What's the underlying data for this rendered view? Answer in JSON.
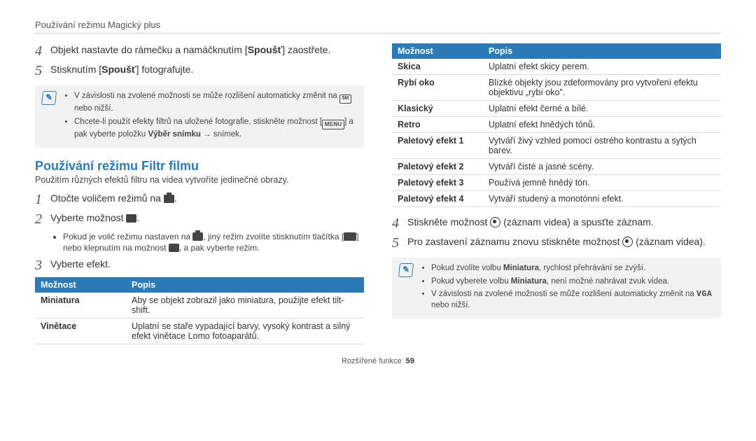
{
  "header": {
    "breadcrumb": "Používání režimu Magický plus"
  },
  "left": {
    "step4": {
      "num": "4",
      "pre": "Objekt nastavte do rámečku a namáčknutím [",
      "bold": "Spoušť",
      "post": "] zaostřete."
    },
    "step5": {
      "num": "5",
      "pre": "Stisknutím [",
      "bold": "Spoušť",
      "post": "] fotografujte."
    },
    "note1": {
      "li1a": "V závislosti na zvolené možnosti se může rozlišení automaticky změnit na ",
      "li1b": " nebo nižší.",
      "li2a": "Chcete-li použít efekty filtrů na uložené fotografie, stiskněte možnost [",
      "li2menu": "MENU",
      "li2b": "] a pak vyberte položku ",
      "li2bold": "Výběr snímku",
      "li2arrow": " → ",
      "li2c": "snímek."
    },
    "section_title": "Používání režimu Filtr filmu",
    "section_sub": "Použitím různých efektů filtru na videa vytvoříte jedinečné obrazy.",
    "s1": {
      "num": "1",
      "text": "Otočte voličem režimů na ",
      "post": "."
    },
    "s2": {
      "num": "2",
      "text": "Vyberte možnost ",
      "post": "."
    },
    "s2_bullet": {
      "a": "Pokud je volič režimu nastaven na ",
      "b": ", jiný režim zvolíte stisknutím tlačítka [",
      "c": "] nebo klepnutím na možnost ",
      "d": ", a pak vyberte režim."
    },
    "s3": {
      "num": "3",
      "text": "Vyberte efekt."
    },
    "table1": {
      "h1": "Možnost",
      "h2": "Popis",
      "rows": [
        {
          "opt": "Miniatura",
          "desc": "Aby se objekt zobrazil jako miniatura, použijte efekt tilt-shift."
        },
        {
          "opt": "Vinětace",
          "desc": "Uplatní se staře vypadající barvy, vysoký kontrast a silný efekt vinětace Lomo fotoaparátů."
        }
      ]
    }
  },
  "right": {
    "table2": {
      "h1": "Možnost",
      "h2": "Popis",
      "rows": [
        {
          "opt": "Skica",
          "desc": "Uplatní efekt skicy perem."
        },
        {
          "opt": "Rybí oko",
          "desc": "Blízké objekty jsou zdeformovány pro vytvoření efektu objektivu „rybí oko\"."
        },
        {
          "opt": "Klasický",
          "desc": "Uplatní efekt černé a bílé."
        },
        {
          "opt": "Retro",
          "desc": "Uplatní efekt hnědých tónů."
        },
        {
          "opt": "Paletový efekt 1",
          "desc": "Vytváří živý vzhled pomocí ostrého kontrastu a sytých barev."
        },
        {
          "opt": "Paletový efekt 2",
          "desc": "Vytváří čisté a jasné scény."
        },
        {
          "opt": "Paletový efekt 3",
          "desc": "Používá jemně hnědý tón."
        },
        {
          "opt": "Paletový efekt 4",
          "desc": "Vytváří studený a monotónní efekt."
        }
      ]
    },
    "step4": {
      "num": "4",
      "text": "Stiskněte možnost ",
      "post": " (záznam videa) a spusťte záznam."
    },
    "step5": {
      "num": "5",
      "text": "Pro zastavení záznamu znovu stiskněte možnost ",
      "post": " (záznam videa)."
    },
    "note2": {
      "li1a": "Pokud zvolíte volbu ",
      "li1bold": "Miniatura",
      "li1b": ", rychlost přehrávání se zvýší.",
      "li2a": "Pokud vyberete volbu ",
      "li2bold": "Miniatura",
      "li2b": ", není možné nahrávat zvuk videa.",
      "li3a": "V závislosti na zvolené možnosti se může rozlišení automaticky změnit na ",
      "li3vga": "VGA",
      "li3b": " nebo nižší."
    }
  },
  "footer": {
    "label": "Rozšířené funkce",
    "page": "59"
  }
}
